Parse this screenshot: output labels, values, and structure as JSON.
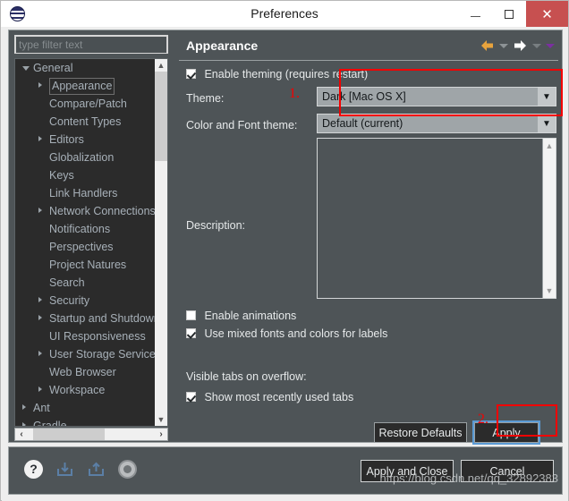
{
  "window": {
    "title": "Preferences",
    "app_icon": "eclipse-icon",
    "controls": {
      "minimize": "minimize-icon",
      "maximize": "maximize-icon",
      "close": "✕"
    }
  },
  "sidebar": {
    "filter": {
      "value": "",
      "placeholder": "type filter text"
    },
    "items": [
      {
        "label": "General",
        "level": 0,
        "expander": "open",
        "selected": false
      },
      {
        "label": "Appearance",
        "level": 1,
        "expander": "collapsed",
        "selected": true
      },
      {
        "label": "Compare/Patch",
        "level": 1,
        "expander": "none",
        "selected": false
      },
      {
        "label": "Content Types",
        "level": 1,
        "expander": "none",
        "selected": false
      },
      {
        "label": "Editors",
        "level": 1,
        "expander": "collapsed",
        "selected": false
      },
      {
        "label": "Globalization",
        "level": 1,
        "expander": "none",
        "selected": false
      },
      {
        "label": "Keys",
        "level": 1,
        "expander": "none",
        "selected": false
      },
      {
        "label": "Link Handlers",
        "level": 1,
        "expander": "none",
        "selected": false
      },
      {
        "label": "Network Connections",
        "level": 1,
        "expander": "collapsed",
        "selected": false
      },
      {
        "label": "Notifications",
        "level": 1,
        "expander": "none",
        "selected": false
      },
      {
        "label": "Perspectives",
        "level": 1,
        "expander": "none",
        "selected": false
      },
      {
        "label": "Project Natures",
        "level": 1,
        "expander": "none",
        "selected": false
      },
      {
        "label": "Search",
        "level": 1,
        "expander": "none",
        "selected": false
      },
      {
        "label": "Security",
        "level": 1,
        "expander": "collapsed",
        "selected": false
      },
      {
        "label": "Startup and Shutdown",
        "level": 1,
        "expander": "collapsed",
        "selected": false
      },
      {
        "label": "UI Responsiveness",
        "level": 1,
        "expander": "none",
        "selected": false
      },
      {
        "label": "User Storage Service",
        "level": 1,
        "expander": "collapsed",
        "selected": false
      },
      {
        "label": "Web Browser",
        "level": 1,
        "expander": "none",
        "selected": false
      },
      {
        "label": "Workspace",
        "level": 1,
        "expander": "collapsed",
        "selected": false
      },
      {
        "label": "Ant",
        "level": 0,
        "expander": "collapsed",
        "selected": false
      },
      {
        "label": "Gradle",
        "level": 0,
        "expander": "collapsed",
        "selected": false
      }
    ]
  },
  "page": {
    "title": "Appearance",
    "nav": {
      "back": "back-arrow-icon",
      "back_menu": "chevron-down-icon",
      "forward": "forward-arrow-icon",
      "forward_menu": "chevron-down-icon",
      "view_menu": "chevron-down-icon"
    },
    "enable_theming": {
      "label": "Enable theming (requires restart)",
      "checked": true
    },
    "theme": {
      "label": "Theme:",
      "value": "Dark [Mac OS X]"
    },
    "color_font_theme": {
      "label": "Color and Font theme:",
      "value": "Default (current)"
    },
    "description": {
      "label": "Description:",
      "value": ""
    },
    "enable_animations": {
      "label": "Enable animations",
      "checked": false
    },
    "mixed_fonts": {
      "label": "Use mixed fonts and colors for labels",
      "checked": true
    },
    "visible_tabs_label": "Visible tabs on overflow:",
    "show_mru_tabs": {
      "label": "Show most recently used tabs",
      "checked": true
    },
    "restore_defaults_button": "Restore Defaults",
    "apply_button": "Apply"
  },
  "footer": {
    "help_icon": "help-icon",
    "import_icon": "import-icon",
    "export_icon": "export-icon",
    "circle_icon": "circle-icon",
    "apply_and_close_button": "Apply and Close",
    "cancel_button": "Cancel",
    "watermark": "https://blog.csdn.net/qq_32892383"
  },
  "annotations": [
    {
      "label": "1."
    },
    {
      "label": "2."
    }
  ],
  "colors": {
    "panel_bg": "#4e5457",
    "tree_bg": "#2b2b2b",
    "accent_red": "#f40000",
    "focus_blue": "#5b9bd5",
    "close_red": "#c75050",
    "back_arrow": "#e8a33d",
    "view_menu_purple": "#7b2fa0"
  }
}
